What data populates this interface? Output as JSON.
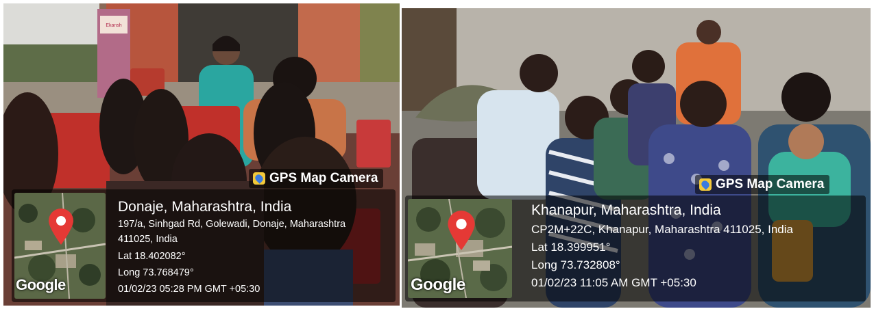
{
  "photos": [
    {
      "app_badge": "GPS Map Camera",
      "location_title": "Donaje, Maharashtra, India",
      "address_line1": "197/a, Sinhgad Rd, Golewadi, Donaje, Maharashtra",
      "address_line2": "411025, India",
      "lat": "Lat 18.402082°",
      "long": "Long 73.768479°",
      "datetime": "01/02/23 05:28 PM GMT +05:30",
      "map_logo": "Google",
      "sign_text": "Ekansh",
      "icons": {
        "badge": "gps-map-camera-icon",
        "pin": "map-pin-icon"
      },
      "colors": {
        "pin": "#e53935",
        "overlay": "#00000080"
      }
    },
    {
      "app_badge": "GPS Map Camera",
      "location_title": "Khanapur, Maharashtra, India",
      "address_line1": "CP2M+22C, Khanapur, Maharashtra 411025, India",
      "lat": "Lat 18.399951°",
      "long": "Long 73.732808°",
      "datetime": "01/02/23 11:05 AM GMT +05:30",
      "map_logo": "Google",
      "icons": {
        "badge": "gps-map-camera-icon",
        "pin": "map-pin-icon"
      },
      "colors": {
        "pin": "#e53935",
        "overlay": "#00000080"
      }
    }
  ]
}
